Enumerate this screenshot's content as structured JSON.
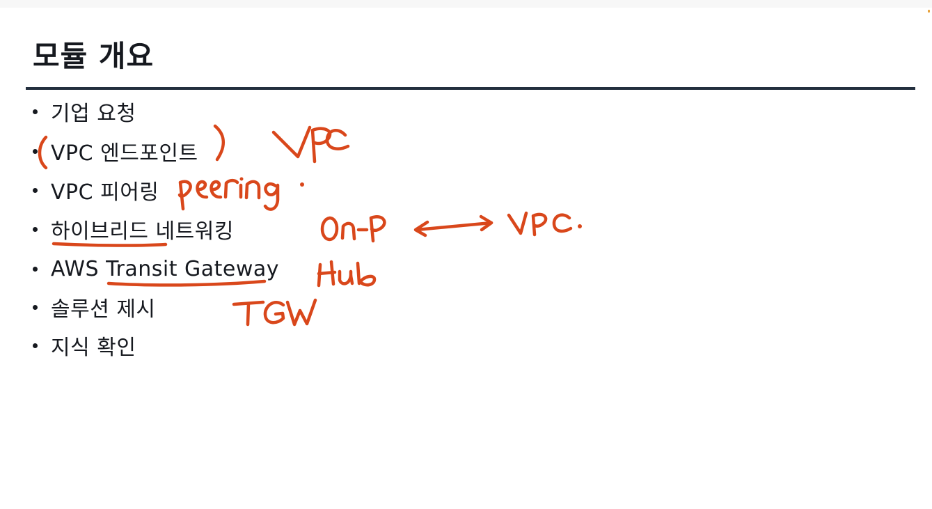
{
  "slide": {
    "title": "모듈 개요",
    "bullets": [
      {
        "label": "기업 요청"
      },
      {
        "label": "VPC 엔드포인트"
      },
      {
        "label": "VPC 피어링"
      },
      {
        "label": "하이브리드 네트워킹"
      },
      {
        "label": "AWS Transit Gateway"
      },
      {
        "label": "솔루션 제시"
      },
      {
        "label": "지식 확인"
      }
    ]
  },
  "handwriting": {
    "notes": [
      "VPC",
      "peering",
      "On-P",
      "VPC.",
      "Hub",
      "TGW"
    ]
  },
  "colors": {
    "title_rule": "#232f3e",
    "ink": "#d9471b",
    "text": "#16191f"
  }
}
